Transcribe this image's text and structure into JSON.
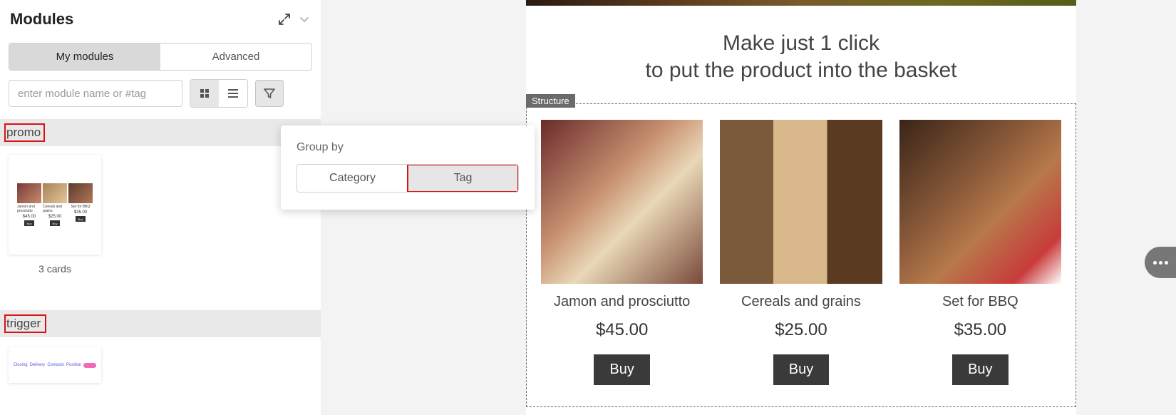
{
  "panel": {
    "title": "Modules",
    "tabs": {
      "my": "My modules",
      "advanced": "Advanced"
    },
    "search_placeholder": "enter module name or #tag"
  },
  "popup": {
    "label": "Group by",
    "category": "Category",
    "tag": "Tag"
  },
  "groups": {
    "promo": "promo",
    "promo_card_caption": "3 cards",
    "trigger": "trigger"
  },
  "thumb": {
    "p1_name": "Jamon and prosciutto",
    "p1_price": "$45.00",
    "p2_name": "Cereals and grains",
    "p2_price": "$25.00",
    "p3_name": "Set for BBQ",
    "p3_price": "$35.00",
    "buy": "Buy"
  },
  "preview": {
    "headline_l1": "Make just 1 click",
    "headline_l2": "to put the product into the basket",
    "structure_label": "Structure",
    "cards": [
      {
        "title": "Jamon and prosciutto",
        "price": "$45.00",
        "buy": "Buy"
      },
      {
        "title": "Cereals and grains",
        "price": "$25.00",
        "buy": "Buy"
      },
      {
        "title": "Set for BBQ",
        "price": "$35.00",
        "buy": "Buy"
      }
    ]
  }
}
